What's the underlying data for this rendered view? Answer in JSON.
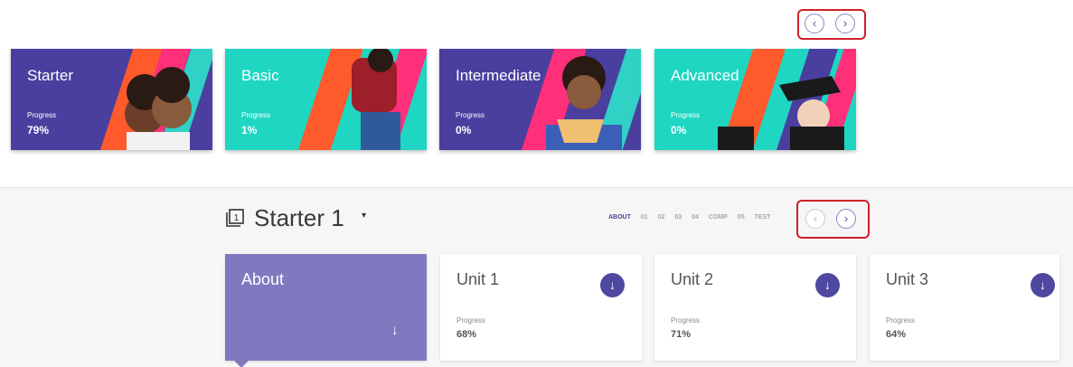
{
  "level_carousel": {
    "prev_icon": "chevron-left-icon",
    "next_icon": "chevron-right-icon",
    "prev_glyph": "‹",
    "next_glyph": "›",
    "highlight_color": "#d0202a",
    "levels": [
      {
        "title": "Starter",
        "progress_label": "Progress",
        "progress_value": "79%",
        "color": "#4a3f9f"
      },
      {
        "title": "Basic",
        "progress_label": "Progress",
        "progress_value": "1%",
        "color": "#1fd6c2"
      },
      {
        "title": "Intermediate",
        "progress_label": "Progress",
        "progress_value": "0%",
        "color": "#4a3f9f"
      },
      {
        "title": "Advanced",
        "progress_label": "Progress",
        "progress_value": "0%",
        "color": "#1fd6c2"
      }
    ]
  },
  "course": {
    "icon": "book-icon",
    "icon_text": "1",
    "title": "Starter 1",
    "dropdown_glyph": "▾",
    "tabs": [
      "ABOUT",
      "01",
      "02",
      "03",
      "04",
      "COMP",
      "05",
      "TEST"
    ],
    "active_tab": "ABOUT",
    "prev_glyph": "‹",
    "next_glyph": "›",
    "units": [
      {
        "title": "About",
        "arrow_glyph": "↓"
      },
      {
        "title": "Unit 1",
        "progress_label": "Progress",
        "progress_value": "68%",
        "arrow_glyph": "↓"
      },
      {
        "title": "Unit 2",
        "progress_label": "Progress",
        "progress_value": "71%",
        "arrow_glyph": "↓"
      },
      {
        "title": "Unit 3",
        "progress_label": "Progress",
        "progress_value": "64%",
        "arrow_glyph": "↓"
      }
    ],
    "accent_color": "#4f48a1",
    "about_color": "#8079c0"
  }
}
